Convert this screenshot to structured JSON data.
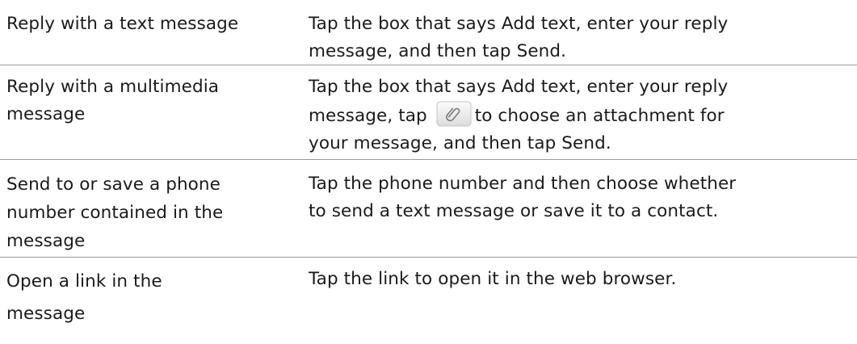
{
  "rows": [
    {
      "action": [
        "Reply with a text message"
      ],
      "how": [
        [
          "Tap the box that says ",
          "Add text",
          ", enter your reply"
        ],
        [
          "message, and then tap ",
          "Send",
          "."
        ]
      ]
    },
    {
      "action": [
        "Reply with a multimedia",
        "message"
      ],
      "how": [
        [
          "Tap the box that says ",
          "Add text",
          ", enter your reply"
        ],
        [
          "message, tap ",
          "to choose an attachment for"
        ],
        [
          "your message, and then tap ",
          "Send",
          "."
        ]
      ],
      "icon": "paperclip-icon"
    },
    {
      "action": [
        "Send to or save a phone",
        "number contained in the",
        "message"
      ],
      "how": [
        [
          "Tap the phone number and then choose whether"
        ],
        [
          "to send a text message or save it to a contact."
        ]
      ]
    },
    {
      "action": [
        "Open a link in the",
        "message"
      ],
      "how": [
        [
          "Tap the link to open it in the web browser."
        ]
      ]
    }
  ]
}
